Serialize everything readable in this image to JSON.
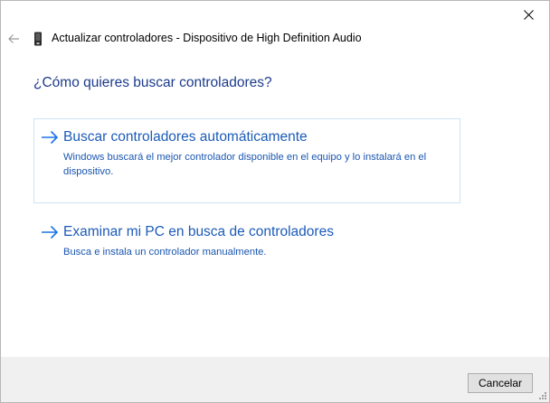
{
  "window": {
    "title": "Actualizar controladores - Dispositivo de High Definition Audio",
    "close_icon": "close-icon",
    "back_icon": "back-arrow-icon",
    "device_icon": "device-icon"
  },
  "main": {
    "heading": "¿Cómo quieres buscar controladores?",
    "options": [
      {
        "title": "Buscar controladores automáticamente",
        "description": "Windows buscará el mejor controlador disponible en el equipo y lo instalará en el dispositivo.",
        "icon": "arrow-right-icon",
        "highlighted": true
      },
      {
        "title": "Examinar mi PC en busca de controladores",
        "description": "Busca e instala un controlador manualmente.",
        "icon": "arrow-right-icon",
        "highlighted": false
      }
    ]
  },
  "footer": {
    "cancel_label": "Cancelar"
  },
  "colors": {
    "heading": "#1c3b8c",
    "link": "#1c5bb8",
    "arrow": "#1a73e8",
    "highlight_border": "#cde3f7",
    "footer_bg": "#f0f0f0"
  }
}
